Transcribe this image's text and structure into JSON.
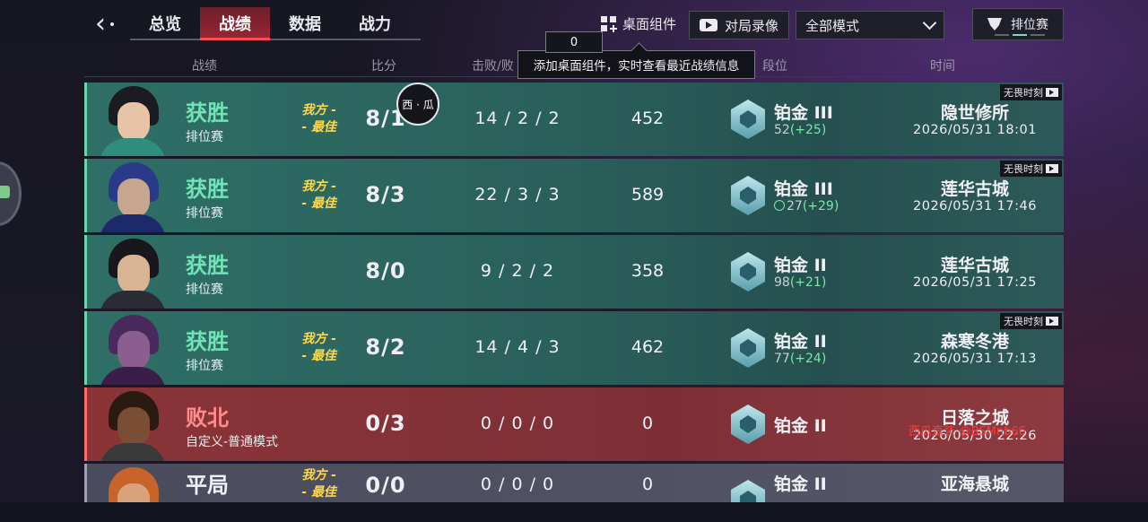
{
  "nav": {
    "tabs": [
      {
        "label": "总览"
      },
      {
        "label": "战绩"
      },
      {
        "label": "数据"
      },
      {
        "label": "战力"
      }
    ],
    "active_tab": "战绩"
  },
  "toolbar": {
    "widget_label": "桌面组件",
    "replay_label": "对局录像",
    "mode_select_value": "全部模式",
    "rank_filter_label": "排位赛"
  },
  "tooltip": {
    "badge": "0",
    "text": "添加桌面组件，实时查看最近战绩信息"
  },
  "columns": {
    "record": "战绩",
    "score": "比分",
    "kda": "击败/败",
    "rank": "段位",
    "time": "时间"
  },
  "float_avatar_text": "西 · 瓜",
  "rows": [
    {
      "result": "获胜",
      "mode": "排位赛",
      "mvp": "我方 -\n- 最佳",
      "score": "8/1",
      "kda": "14 / 2 / 2",
      "acs": "452",
      "rank": "铂金 III",
      "rr": "52",
      "rr_gain": "(+25)",
      "map": "隐世修所",
      "time": "2026/05/31 18:01",
      "tag": "无畏时刻"
    },
    {
      "result": "获胜",
      "mode": "排位赛",
      "mvp": "我方 -\n- 最佳",
      "score": "8/3",
      "kda": "22 / 3 / 3",
      "acs": "589",
      "rank": "铂金 III",
      "rr": "27",
      "rr_gain": "(+29)",
      "map": "莲华古城",
      "time": "2026/05/31 17:46",
      "tag": "无畏时刻"
    },
    {
      "result": "获胜",
      "mode": "排位赛",
      "mvp": "",
      "score": "8/0",
      "kda": "9 / 2 / 2",
      "acs": "358",
      "rank": "铂金 II",
      "rr": "98",
      "rr_gain": "(+21)",
      "map": "莲华古城",
      "time": "2026/05/31 17:25",
      "tag": ""
    },
    {
      "result": "获胜",
      "mode": "排位赛",
      "mvp": "我方 -\n- 最佳",
      "score": "8/2",
      "kda": "14 / 4 / 3",
      "acs": "462",
      "rank": "铂金 II",
      "rr": "77",
      "rr_gain": "(+24)",
      "map": "森寒冬港",
      "time": "2026/05/31 17:13",
      "tag": "无畏时刻"
    },
    {
      "result": "败北",
      "mode": "自定义-普通模式",
      "mvp": "",
      "score": "0/3",
      "kda": "0 / 0 / 0",
      "acs": "0",
      "rank": "铂金 II",
      "rr": "",
      "rr_gain": "",
      "map": "日落之城",
      "time": "2026/05/30 22:26",
      "tag": "",
      "watermark": "西瓜直装-@BSMnb66"
    },
    {
      "result": "平局",
      "mode": "",
      "mvp": "我方 -\n- 最佳",
      "score": "0/0",
      "kda": "0 / 0 / 0",
      "acs": "0",
      "rank": "铂金 II",
      "rr": "",
      "rr_gain": "",
      "map": "亚海悬城",
      "time": "",
      "tag": ""
    }
  ],
  "colors": {
    "win_text": "#72e3b8",
    "loss_text": "#ff8b8b",
    "mvp_text": "#ffd84a",
    "rr_gain": "#7ae8a8",
    "active_tab": "#9a2634"
  }
}
